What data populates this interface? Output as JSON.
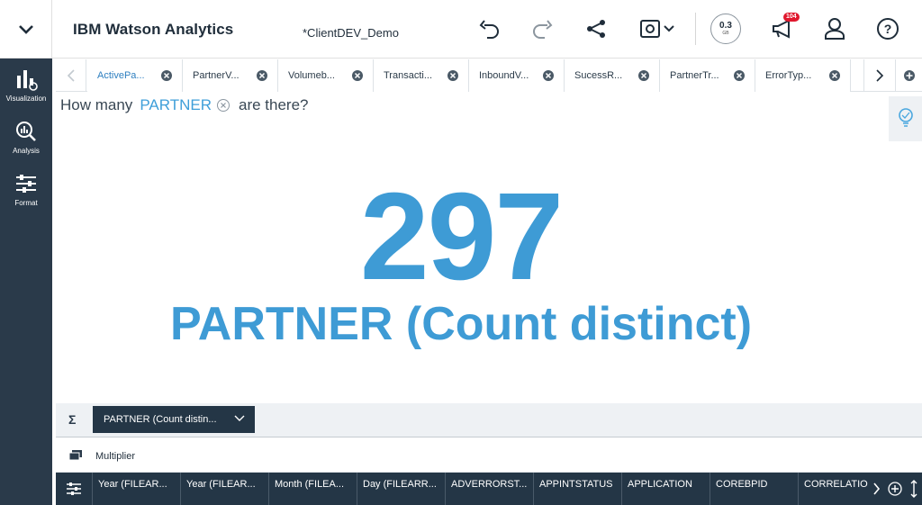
{
  "header": {
    "app_title": "IBM Watson Analytics",
    "doc_title": "*ClientDEV_Demo",
    "storage": {
      "value": "0.3",
      "unit": "GB"
    },
    "notifications_count": "104"
  },
  "sidebar": {
    "items": [
      {
        "label": "Visualization",
        "icon": "bar-chart-icon"
      },
      {
        "label": "Analysis",
        "icon": "magnifier-chart-icon"
      },
      {
        "label": "Format",
        "icon": "sliders-icon"
      }
    ]
  },
  "tabs": [
    {
      "label": "ActivePa...",
      "active": true
    },
    {
      "label": "PartnerV...",
      "active": false
    },
    {
      "label": "Volumeb...",
      "active": false
    },
    {
      "label": "Transacti...",
      "active": false
    },
    {
      "label": "InboundV...",
      "active": false
    },
    {
      "label": "SucessR...",
      "active": false
    },
    {
      "label": "PartnerTr...",
      "active": false
    },
    {
      "label": "ErrorTyp...",
      "active": false
    }
  ],
  "question": {
    "prefix": "How many",
    "field": "PARTNER",
    "suffix": "are there?"
  },
  "kpi": {
    "value": "297",
    "label": "PARTNER (Count distinct)"
  },
  "slots": {
    "measure_pill": "PARTNER (Count distin...",
    "multiplier_label": "Multiplier"
  },
  "columns": [
    "Year (FILEAR...",
    "Year (FILEAR...",
    "Month (FILEA...",
    "Day (FILEARR...",
    "ADVERRORST...",
    "APPINTSTATUS",
    "APPLICATION",
    "COREBPID",
    "CORRELATIO"
  ],
  "colors": {
    "accent": "#3e9bd5",
    "sidebar": "#2a3a4a",
    "dark_bar": "#243646",
    "badge": "#e0182d"
  }
}
